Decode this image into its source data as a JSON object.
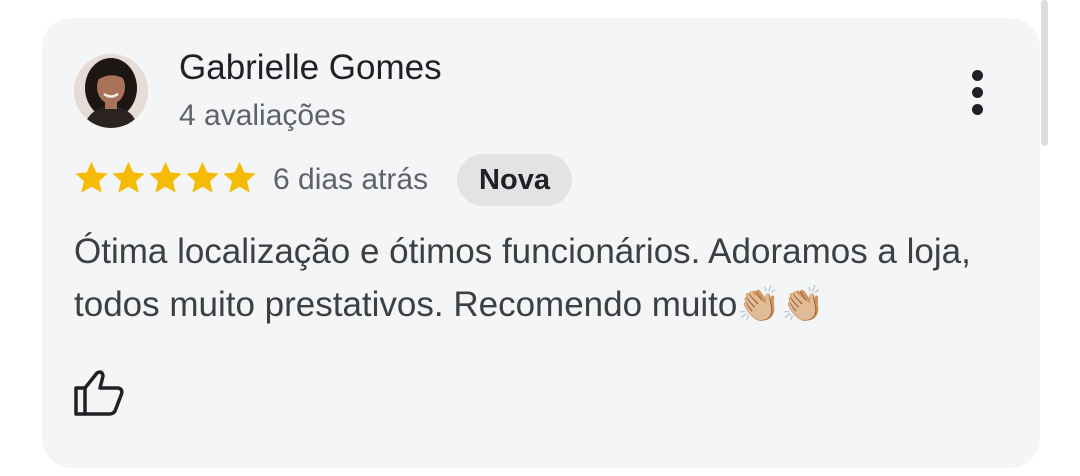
{
  "review": {
    "author_name": "Gabrielle Gomes",
    "author_reviews_count": "4 avaliações",
    "rating": 5,
    "max_rating": 5,
    "time_ago": "6 dias atrás",
    "badge": "Nova",
    "text": "Ótima localização e ótimos funcionários. Adoramos a loja, todos muito prestativos. Recomendo muito👏🏼👏🏼"
  },
  "icons": {
    "menu": "more-vert-icon",
    "star": "star-icon",
    "like": "thumb-up-icon"
  },
  "colors": {
    "star": "#f6bb06",
    "card_background": "#f4f5f7",
    "badge_background": "#e3e3e5"
  }
}
